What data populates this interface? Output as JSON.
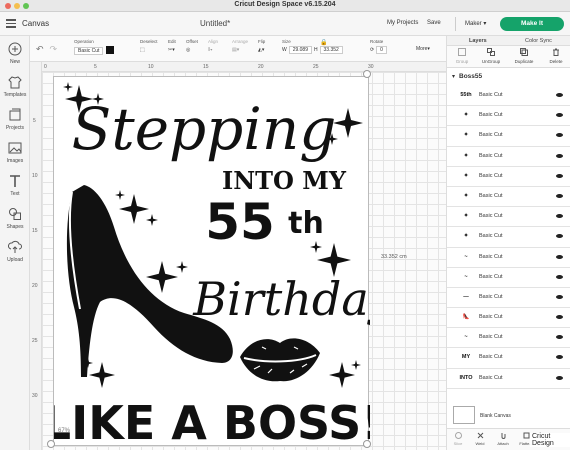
{
  "window": {
    "app_title": "Cricut Design Space  v6.15.204"
  },
  "header": {
    "canvas_label": "Canvas",
    "doc_title": "Untitled*",
    "my_projects": "My Projects",
    "save": "Save",
    "machine": "Maker",
    "make_it": "Make It",
    "accent_color": "#15a36a"
  },
  "left_rail": [
    {
      "label": "New",
      "icon": "plus-icon"
    },
    {
      "label": "Templates",
      "icon": "shirt-icon"
    },
    {
      "label": "Projects",
      "icon": "projects-icon"
    },
    {
      "label": "Images",
      "icon": "image-icon"
    },
    {
      "label": "Text",
      "icon": "text-icon"
    },
    {
      "label": "Shapes",
      "icon": "shapes-icon"
    },
    {
      "label": "Upload",
      "icon": "upload-icon"
    }
  ],
  "toolbar": {
    "operation_label": "Operation",
    "operation_value": "Basic Cut",
    "deselect": "Deselect",
    "edit": "Edit",
    "offset": "Offset",
    "align": "Align",
    "arrange": "Arrange",
    "flip": "Flip",
    "size": "Size",
    "w_label": "W",
    "w_value": "29.089",
    "h_label": "H",
    "h_value": "33.352",
    "rotate": "Rotate",
    "rotate_value": "0",
    "more": "More"
  },
  "rulers": {
    "top": [
      "0",
      "5",
      "10",
      "15",
      "20",
      "25",
      "30"
    ],
    "left": [
      "5",
      "10",
      "15",
      "20",
      "25",
      "30"
    ]
  },
  "canvas": {
    "height_label": "33.352 cm",
    "zoom": "67%",
    "design": {
      "line1": "Stepping",
      "line2": "INTO MY",
      "line3_number": "55",
      "line3_suffix": "th",
      "line4": "Birthday",
      "line5": "LIKE A BOSS!"
    }
  },
  "right_panel": {
    "tabs": [
      "Layers",
      "Color Sync"
    ],
    "actions": [
      "Group",
      "UnGroup",
      "Duplicate",
      "Delete"
    ],
    "group_name": "Boss55",
    "layers": [
      {
        "thumb": "55th",
        "name": "Basic Cut"
      },
      {
        "thumb": "✦",
        "name": "Basic Cut"
      },
      {
        "thumb": "✦",
        "name": "Basic Cut"
      },
      {
        "thumb": "✦",
        "name": "Basic Cut"
      },
      {
        "thumb": "✦",
        "name": "Basic Cut"
      },
      {
        "thumb": "✦",
        "name": "Basic Cut"
      },
      {
        "thumb": "✦",
        "name": "Basic Cut"
      },
      {
        "thumb": "✦",
        "name": "Basic Cut"
      },
      {
        "thumb": "~",
        "name": "Basic Cut"
      },
      {
        "thumb": "~",
        "name": "Basic Cut"
      },
      {
        "thumb": "—",
        "name": "Basic Cut"
      },
      {
        "thumb": "👠",
        "name": "Basic Cut"
      },
      {
        "thumb": "~",
        "name": "Basic Cut"
      },
      {
        "thumb": "MY",
        "name": "Basic Cut"
      },
      {
        "thumb": "INTO",
        "name": "Basic Cut"
      }
    ],
    "blank_canvas": "Blank Canvas",
    "bottom_actions": [
      "Slice",
      "Weld",
      "Attach",
      "Flatte..."
    ],
    "watermark": "Cricut Design"
  }
}
